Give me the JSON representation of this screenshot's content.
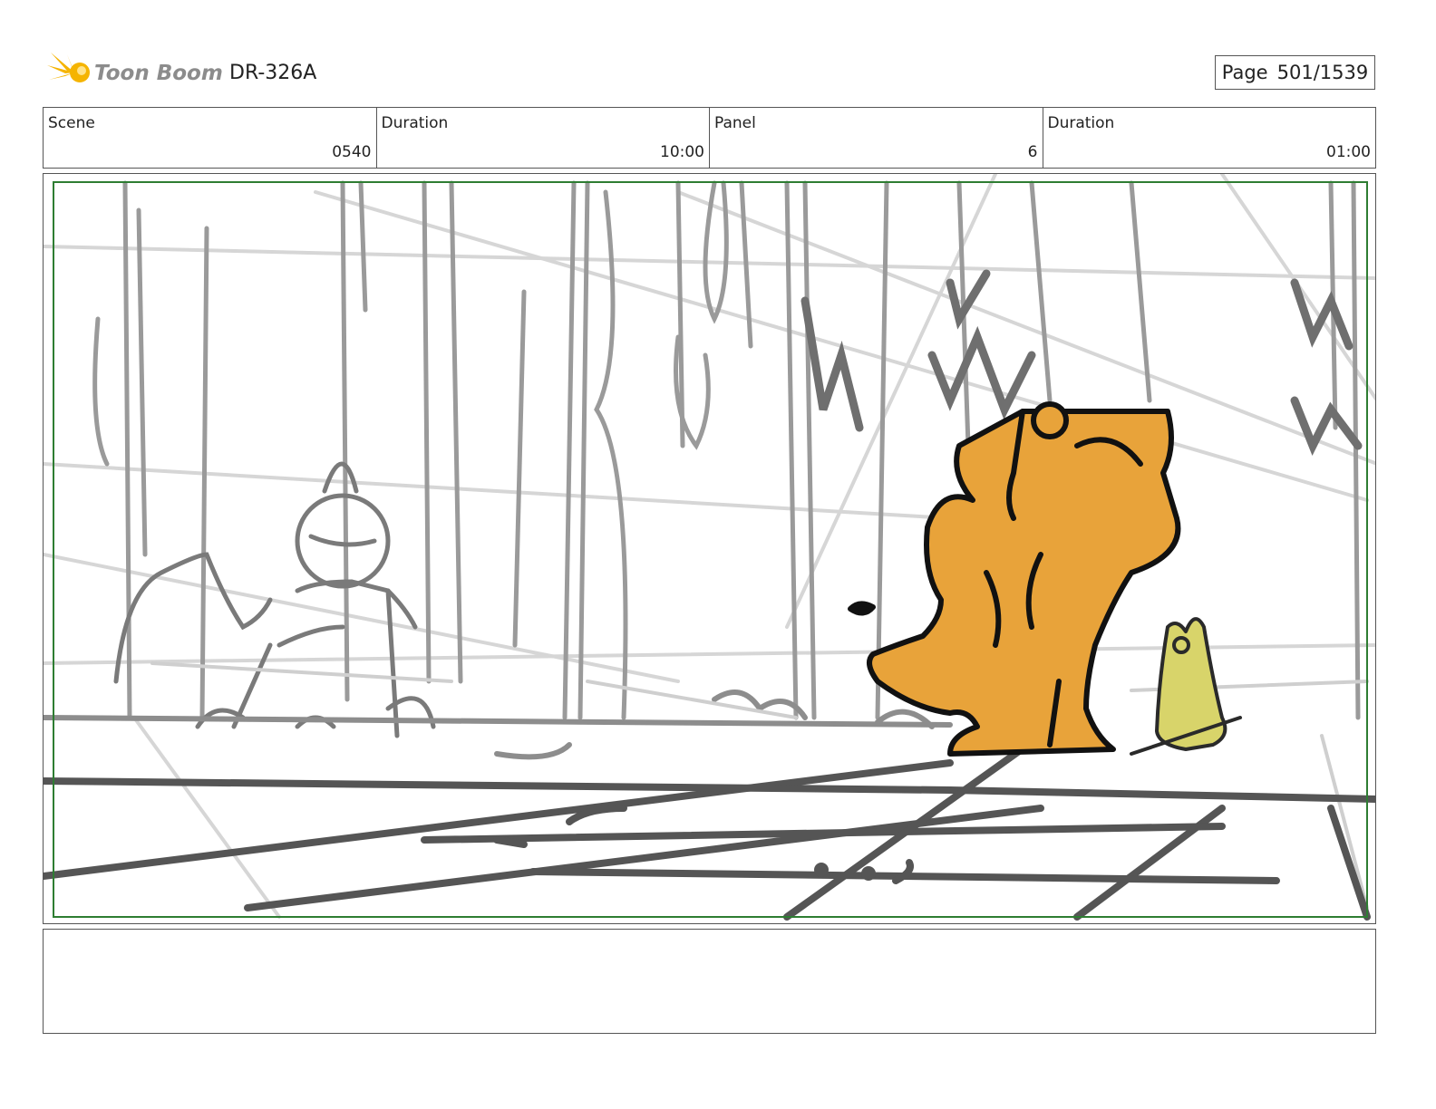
{
  "header": {
    "brand": "Toon Boom",
    "project_code": "DR-326A",
    "page_label": "Page",
    "page_value": "501/1539"
  },
  "info": [
    {
      "label": "Scene",
      "value": "0540"
    },
    {
      "label": "Duration",
      "value": "10:00"
    },
    {
      "label": "Panel",
      "value": "6"
    },
    {
      "label": "Duration",
      "value": "01:00"
    }
  ],
  "panel": {
    "description": "",
    "colors": {
      "safe_frame": "#2e7d32",
      "character_fill": "#e8a33a",
      "small_character_fill": "#d8d46a",
      "ink": "#111111",
      "sketch": "#8a8a8a"
    }
  },
  "notes": {
    "text": ""
  }
}
